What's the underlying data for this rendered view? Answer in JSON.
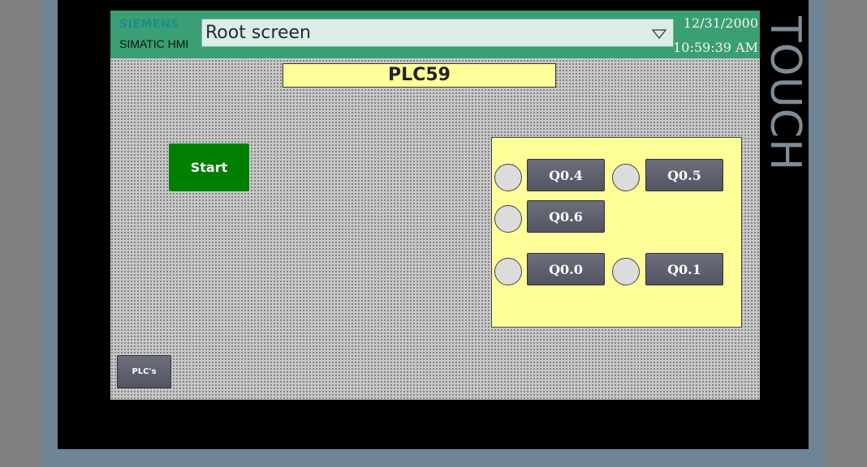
{
  "device": {
    "brand_vertical": "TOUCH"
  },
  "header": {
    "logo": "SIEMENS",
    "product": "SIMATIC HMI",
    "screen_selector": "Root screen",
    "date": "12/31/2000",
    "time": "10:59:39 AM"
  },
  "main": {
    "title": "PLC59",
    "start_label": "Start",
    "outputs": [
      {
        "label": "Q0.4"
      },
      {
        "label": "Q0.5"
      },
      {
        "label": "Q0.6"
      },
      {
        "label": "Q0.0"
      },
      {
        "label": "Q0.1"
      }
    ],
    "nav_button_label": "PLC's"
  },
  "colors": {
    "header_bg": "#3a9f74",
    "title_bg": "#ffff99",
    "start_bg": "#008000",
    "button_bg": "#5e606d",
    "lamp_off": "#dcdcdc"
  }
}
